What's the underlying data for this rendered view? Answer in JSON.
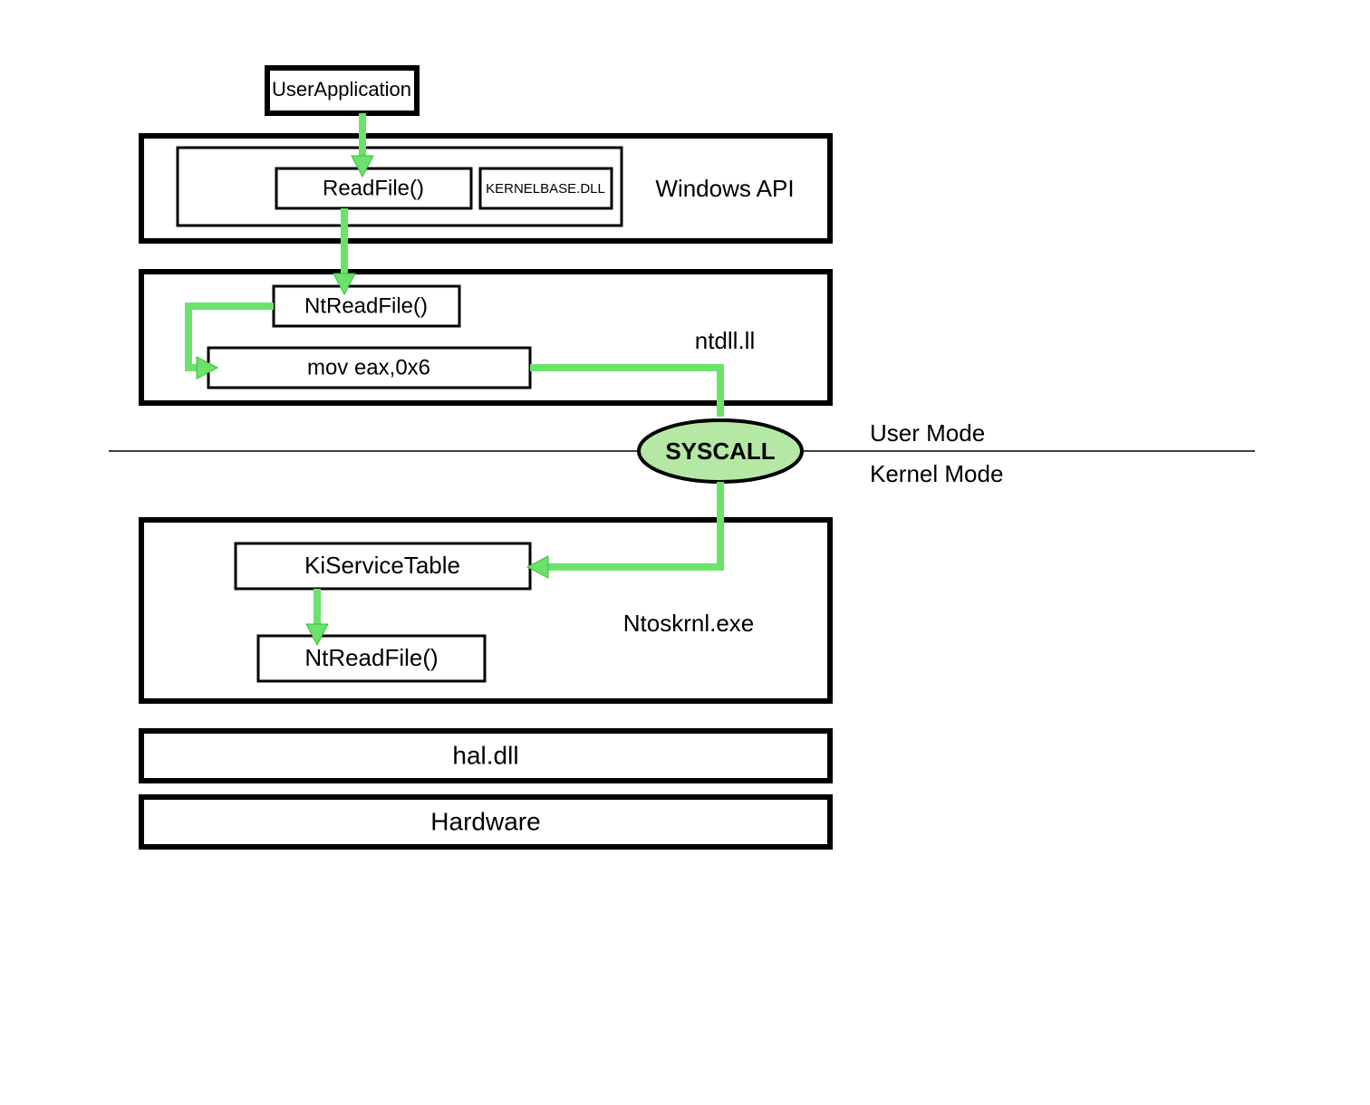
{
  "nodes": {
    "userApp": "UserApplication",
    "readFile": "ReadFile()",
    "kernelbase": "KERNELBASE.DLL",
    "windowsApi": "Windows API",
    "ntReadFile1": "NtReadFile()",
    "movEax": "mov eax,0x6",
    "ntdll": "ntdll.ll",
    "syscall": "SYSCALL",
    "userMode": "User Mode",
    "kernelMode": "Kernel Mode",
    "kiServiceTable": "KiServiceTable",
    "ntReadFile2": "NtReadFile()",
    "ntoskrnl": "Ntoskrnl.exe",
    "haldll": "hal.dll",
    "hardware": "Hardware"
  },
  "colors": {
    "arrow": "#6be36b",
    "syscall_fill": "#b5e8a5"
  }
}
